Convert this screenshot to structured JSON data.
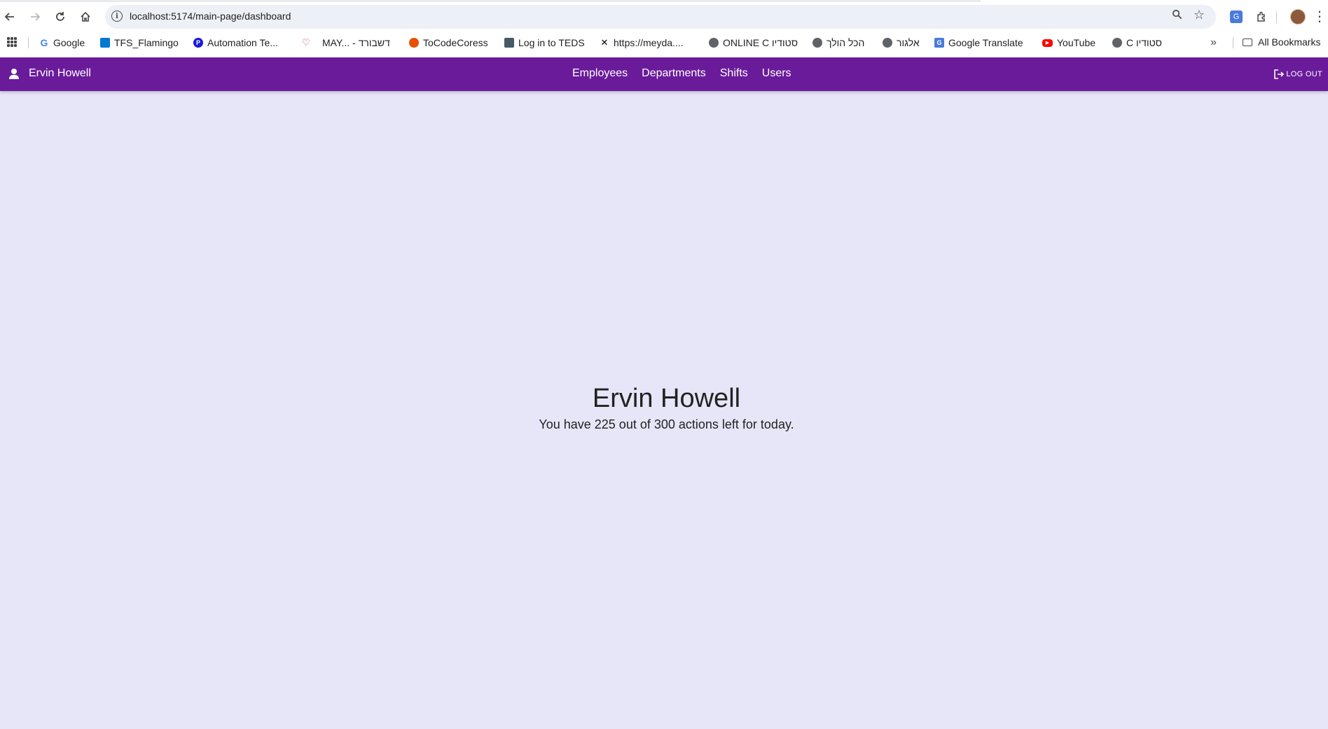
{
  "browser": {
    "url": "localhost:5174/main-page/dashboard",
    "bookmarks": [
      {
        "label": "Google",
        "icon": "google-icon",
        "color": "#4285f4"
      },
      {
        "label": "TFS_Flamingo",
        "icon": "azure-devops-icon",
        "color": "#0078d4"
      },
      {
        "label": "Automation Te...",
        "icon": "p-icon",
        "color": "#1a1adb"
      },
      {
        "label": "MAY... - דשבורד",
        "icon": "heart-icon",
        "color": "#c2185b"
      },
      {
        "label": "ToCodeCoress",
        "icon": "tocode-icon",
        "color": "#e65100"
      },
      {
        "label": "Log in to TEDS",
        "icon": "teds-icon",
        "color": "#455a64"
      },
      {
        "label": "https://meyda....",
        "icon": "meyda-icon",
        "color": "#000000"
      },
      {
        "label": "ONLINE C סטודיו",
        "icon": "globe-icon",
        "color": "#5f6368"
      },
      {
        "label": "הכל הולך",
        "icon": "globe-icon",
        "color": "#5f6368"
      },
      {
        "label": "אלגור",
        "icon": "globe-icon",
        "color": "#5f6368"
      },
      {
        "label": "Google Translate",
        "icon": "translate-icon",
        "color": "#4a7bdc"
      },
      {
        "label": "YouTube",
        "icon": "youtube-icon",
        "color": "#ff0000"
      },
      {
        "label": "C סטודיו",
        "icon": "globe-icon",
        "color": "#5f6368"
      }
    ],
    "all_bookmarks": "All Bookmarks"
  },
  "app": {
    "accent": "#6a1b9a",
    "background": "#e6e6f8",
    "user_name": "Ervin Howell",
    "nav": [
      "Employees",
      "Departments",
      "Shifts",
      "Users"
    ],
    "logout_label": "LOG OUT"
  },
  "main": {
    "greeting": "Ervin Howell",
    "actions_text": "You have 225 out of 300 actions left for today."
  }
}
